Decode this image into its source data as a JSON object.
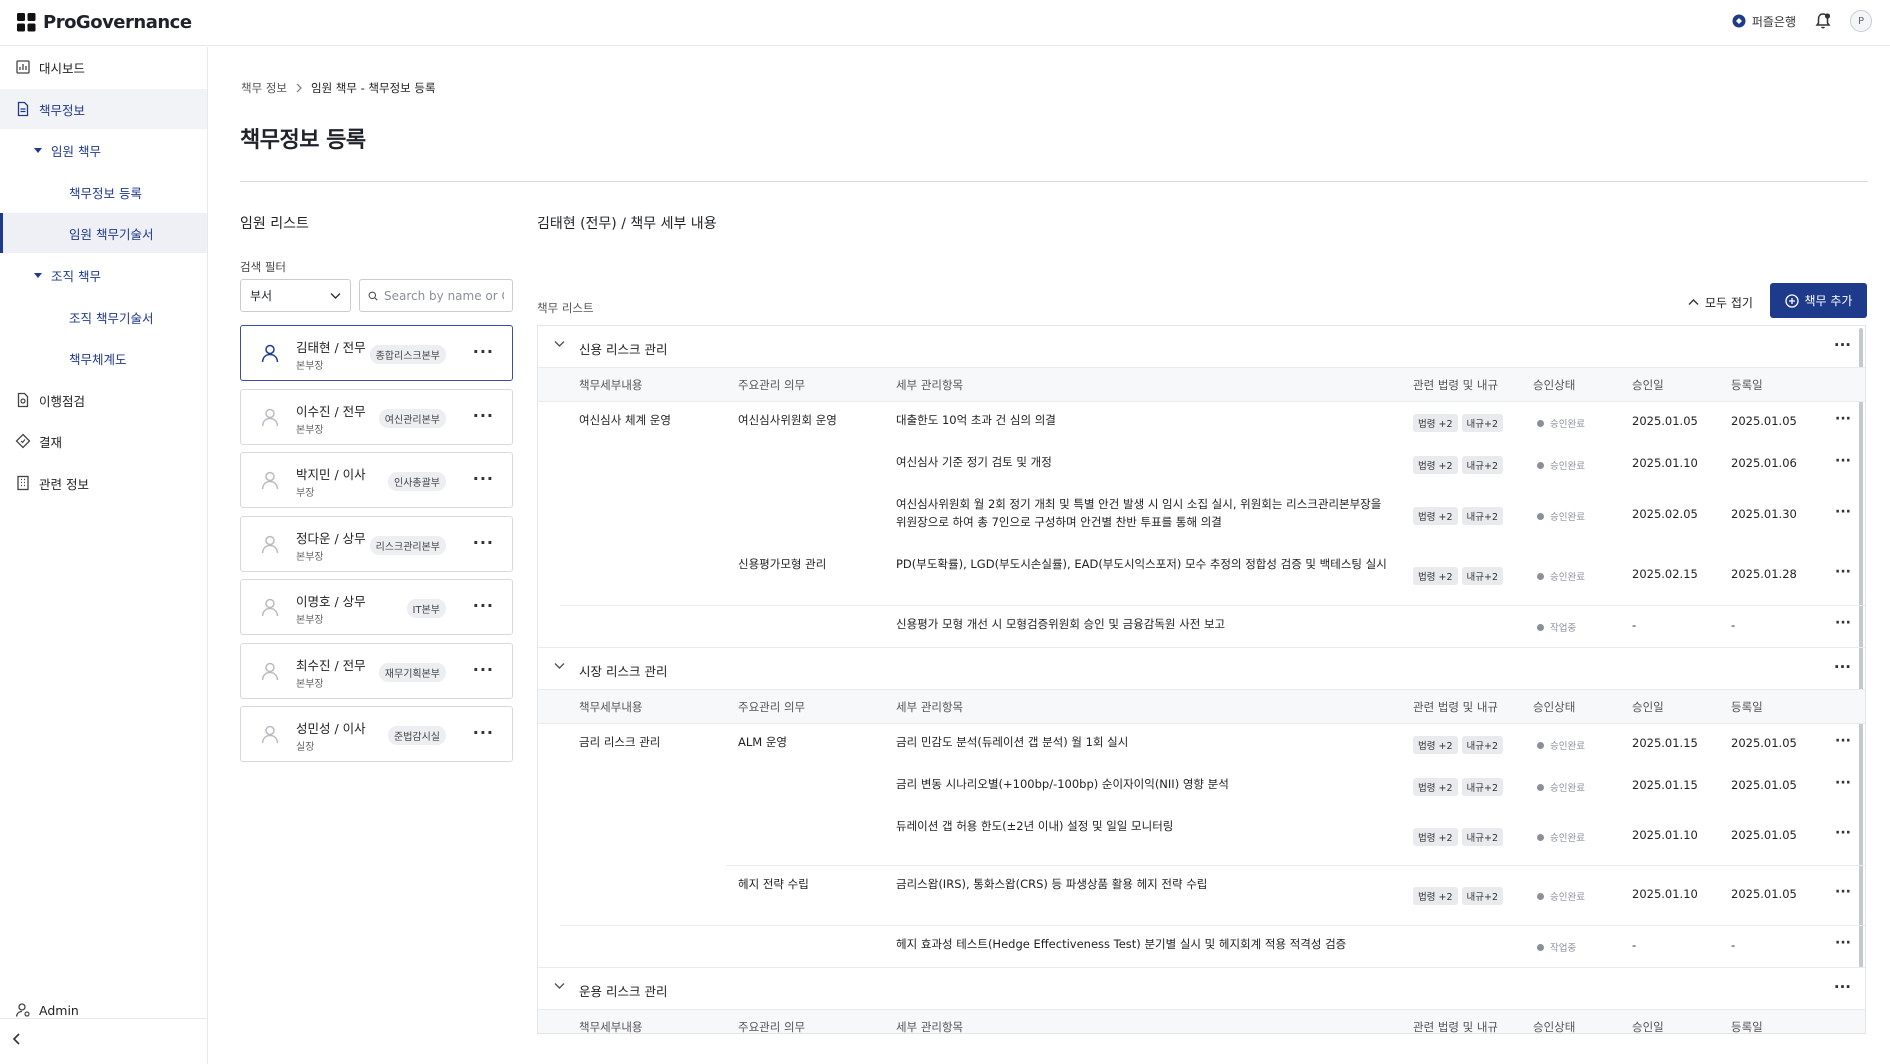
{
  "app": {
    "name": "ProGovernance",
    "bank": "퍼즐은행",
    "user_initial": "P"
  },
  "sidebar": {
    "items": [
      {
        "label": "대시보드"
      },
      {
        "label": "책무정보"
      },
      {
        "label": "임원 책무"
      },
      {
        "label": "책무정보 등록"
      },
      {
        "label": "임원 책무기술서"
      },
      {
        "label": "조직 책무"
      },
      {
        "label": "조직 책무기술서"
      },
      {
        "label": "책무체계도"
      },
      {
        "label": "이행점검"
      },
      {
        "label": "결재"
      },
      {
        "label": "관련 정보"
      }
    ],
    "admin": "Admin"
  },
  "breadcrumb": {
    "parent": "책무 정보",
    "current": "임원 책무 - 책무정보 등록"
  },
  "page_title": "책무정보 등록",
  "employee_panel": {
    "title": "임원 리스트",
    "filter_label": "검색 필터",
    "filter_select": "부서",
    "search_placeholder": "Search by name or G",
    "employees": [
      {
        "name": "김태현 / 전무",
        "rank": "본부장",
        "dept": "종합리스크본부"
      },
      {
        "name": "이수진 / 전무",
        "rank": "본부장",
        "dept": "여신관리본부"
      },
      {
        "name": "박지민 / 이사",
        "rank": "부장",
        "dept": "인사총괄부"
      },
      {
        "name": "정다운 / 상무",
        "rank": "본부장",
        "dept": "리스크관리본부"
      },
      {
        "name": "이명호 / 상무",
        "rank": "본부장",
        "dept": "IT본부"
      },
      {
        "name": "최수진 / 전무",
        "rank": "본부장",
        "dept": "재무기획본부"
      },
      {
        "name": "성민성 / 이사",
        "rank": "실장",
        "dept": "준법감시실"
      }
    ]
  },
  "detail": {
    "title": "김태현 (전무) / 책무 세부 내용",
    "list_label": "책무 리스트",
    "collapse_all": "모두 접기",
    "add_button": "책무 추가",
    "columns": [
      "책무세부내용",
      "주요관리 의무",
      "세부 관리항목",
      "관련 법령 및 내규",
      "승인상태",
      "승인일",
      "등록일"
    ],
    "groups": [
      {
        "name": "신용 리스크 관리",
        "rows": [
          {
            "resp": "여신심사 체계 운영",
            "duty": "여신심사위원회 운영",
            "item": "대출한도 10억 초과 건 심의 의결",
            "item2": "",
            "law": "법령 +2",
            "rule": "내규+2",
            "status": "승인완료",
            "approved": "2025.01.05",
            "registered": "2025.01.05"
          },
          {
            "resp": "",
            "duty": "",
            "item": "여신심사 기준 정기 검토 및 개정",
            "item2": "",
            "law": "법령 +2",
            "rule": "내규+2",
            "status": "승인완료",
            "approved": "2025.01.10",
            "registered": "2025.01.06"
          },
          {
            "resp": "",
            "duty": "",
            "item": "여신심사위원회 월 2회 정기 개최 및 특별 안건 발생 시 임시 소집 실시, 위원회는 리스크관리본부장을",
            "item2": "위원장으로 하여 총 7인으로 구성하며 안건별 찬반 투표를 통해 의결",
            "law": "법령 +2",
            "rule": "내규+2",
            "status": "승인완료",
            "approved": "2025.02.05",
            "registered": "2025.01.30"
          },
          {
            "resp": "",
            "duty": "신용평가모형 관리",
            "item": "PD(부도확률), LGD(부도시손실률), EAD(부도시익스포저) 모수 추정의 정합성 검증 및 백테스팅 실시",
            "item2": "",
            "law": "법령 +2",
            "rule": "내규+2",
            "status": "승인완료",
            "approved": "2025.02.15",
            "registered": "2025.01.28"
          },
          {
            "resp": "",
            "duty": "",
            "item": "신용평가 모형 개선 시 모형검증위원회 승인 및 금융감독원 사전 보고",
            "item2": "",
            "law": "",
            "rule": "",
            "status": "작업중",
            "approved": "-",
            "registered": "-"
          }
        ]
      },
      {
        "name": "시장 리스크 관리",
        "rows": [
          {
            "resp": "금리 리스크 관리",
            "duty": "ALM 운영",
            "item": "금리 민감도 분석(듀레이션 갭 분석) 월 1회 실시",
            "item2": "",
            "law": "법령 +2",
            "rule": "내규+2",
            "status": "승인완료",
            "approved": "2025.01.15",
            "registered": "2025.01.05"
          },
          {
            "resp": "",
            "duty": "",
            "item": "금리 변동 시나리오별(+100bp/-100bp) 순이자이익(NII) 영향 분석",
            "item2": "",
            "law": "법령 +2",
            "rule": "내규+2",
            "status": "승인완료",
            "approved": "2025.01.15",
            "registered": "2025.01.05"
          },
          {
            "resp": "",
            "duty": "",
            "item": "듀레이션 갭 허용 한도(±2년 이내) 설정 및 일일 모니터링",
            "item2": "",
            "law": "법령 +2",
            "rule": "내규+2",
            "status": "승인완료",
            "approved": "2025.01.10",
            "registered": "2025.01.05"
          },
          {
            "resp": "",
            "duty": "헤지 전략 수립",
            "item": "금리스왑(IRS), 통화스왑(CRS) 등 파생상품 활용 헤지 전략 수립",
            "item2": "",
            "law": "법령 +2",
            "rule": "내규+2",
            "status": "승인완료",
            "approved": "2025.01.10",
            "registered": "2025.01.05"
          },
          {
            "resp": "",
            "duty": "",
            "item": "헤지 효과성 테스트(Hedge Effectiveness Test) 분기별 실시 및 헤지회계 적용 적격성 검증",
            "item2": "",
            "law": "",
            "rule": "",
            "status": "작업중",
            "approved": "-",
            "registered": "-"
          }
        ]
      },
      {
        "name": "운용 리스크 관리",
        "rows": []
      }
    ]
  }
}
